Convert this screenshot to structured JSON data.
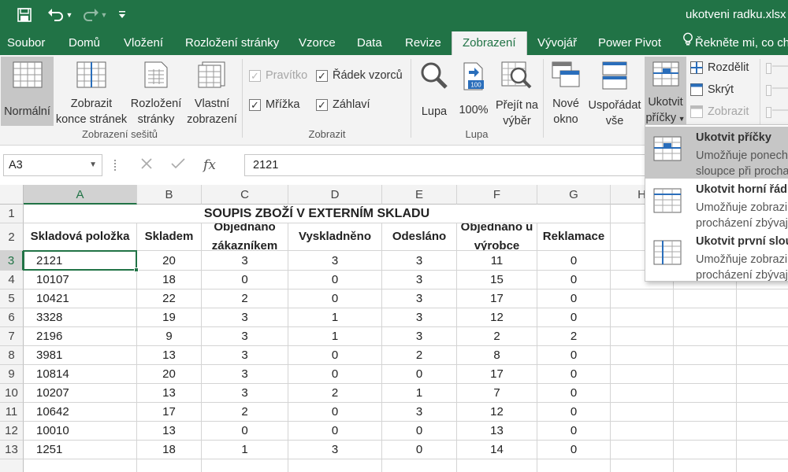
{
  "title_bar": {
    "document_title": "ukotveni radku.xlsx -"
  },
  "tabs": [
    "Soubor",
    "Domů",
    "Vložení",
    "Rozložení stránky",
    "Vzorce",
    "Data",
    "Revize",
    "Zobrazení",
    "Vývojář",
    "Power Pivot",
    "Řekněte mi, co ch"
  ],
  "ribbon": {
    "workbook_views": {
      "label": "Zobrazení sešitů",
      "normal": "Normální",
      "page_break_1": "Zobrazit",
      "page_break_2": "konce stránek",
      "page_layout_1": "Rozložení",
      "page_layout_2": "stránky",
      "custom_1": "Vlastní",
      "custom_2": "zobrazení"
    },
    "show": {
      "label": "Zobrazit",
      "ruler": "Pravítko",
      "formula_bar": "Řádek vzorců",
      "gridlines": "Mřížka",
      "headings": "Záhlaví"
    },
    "zoom": {
      "label": "Lupa",
      "zoom": "Lupa",
      "hundred": "100%",
      "hundred_badge": "100",
      "to_selection_1": "Přejít na",
      "to_selection_2": "výběr"
    },
    "window": {
      "new_window_1": "Nové",
      "new_window_2": "okno",
      "arrange_1": "Uspořádat",
      "arrange_2": "vše",
      "freeze_1": "Ukotvit",
      "freeze_2": "příčky",
      "split": "Rozdělit",
      "hide": "Skrýt",
      "unhide": "Zobrazit"
    }
  },
  "formula_bar": {
    "name_box": "A3",
    "formula": "2121"
  },
  "sheet": {
    "columns": [
      "A",
      "B",
      "C",
      "D",
      "E",
      "F",
      "G",
      "H"
    ],
    "row_numbers": [
      "1",
      "2",
      "3",
      "4",
      "5",
      "6",
      "7",
      "8",
      "9",
      "10",
      "11",
      "12",
      "13"
    ],
    "title": "SOUPIS ZBOŽÍ V EXTERNÍM SKLADU",
    "headers": [
      "Skladová položka",
      "Skladem",
      "Objednáno zákazníkem",
      "Vyskladněno",
      "Odesláno",
      "Objednáno u výrobce",
      "Reklamace"
    ],
    "rows": [
      [
        "2121",
        "20",
        "3",
        "3",
        "3",
        "11",
        "0"
      ],
      [
        "10107",
        "18",
        "0",
        "0",
        "3",
        "15",
        "0"
      ],
      [
        "10421",
        "22",
        "2",
        "0",
        "3",
        "17",
        "0"
      ],
      [
        "3328",
        "19",
        "3",
        "1",
        "3",
        "12",
        "0"
      ],
      [
        "2196",
        "9",
        "3",
        "1",
        "3",
        "2",
        "2"
      ],
      [
        "3981",
        "13",
        "3",
        "0",
        "2",
        "8",
        "0"
      ],
      [
        "10814",
        "20",
        "3",
        "0",
        "0",
        "17",
        "0"
      ],
      [
        "10207",
        "13",
        "3",
        "2",
        "1",
        "7",
        "0"
      ],
      [
        "10642",
        "17",
        "2",
        "0",
        "3",
        "12",
        "0"
      ],
      [
        "10010",
        "13",
        "0",
        "0",
        "0",
        "13",
        "0"
      ],
      [
        "1251",
        "18",
        "1",
        "3",
        "0",
        "14",
        "0"
      ]
    ]
  },
  "freeze_menu": [
    {
      "title": "Ukotvit příčky",
      "line1": "Umožňuje ponech",
      "line2": "sloupce při procha"
    },
    {
      "title": "Ukotvit horní řád",
      "line1": "Umožňuje zobrazi",
      "line2": "procházení zbývaj"
    },
    {
      "title": "Ukotvit první slou",
      "line1": "Umožňuje zobrazi",
      "line2": "procházení zbývaj"
    }
  ],
  "colors": {
    "excel_green": "#217346",
    "ribbon_bg": "#f3f3f3",
    "pressed": "#c6c6c6"
  },
  "icons": [
    "save-icon",
    "undo-icon",
    "redo-icon",
    "customize-qat-icon",
    "lightbulb-icon",
    "search-magnifier-icon",
    "fx-icon",
    "cancel-x-icon",
    "enter-check-icon"
  ]
}
